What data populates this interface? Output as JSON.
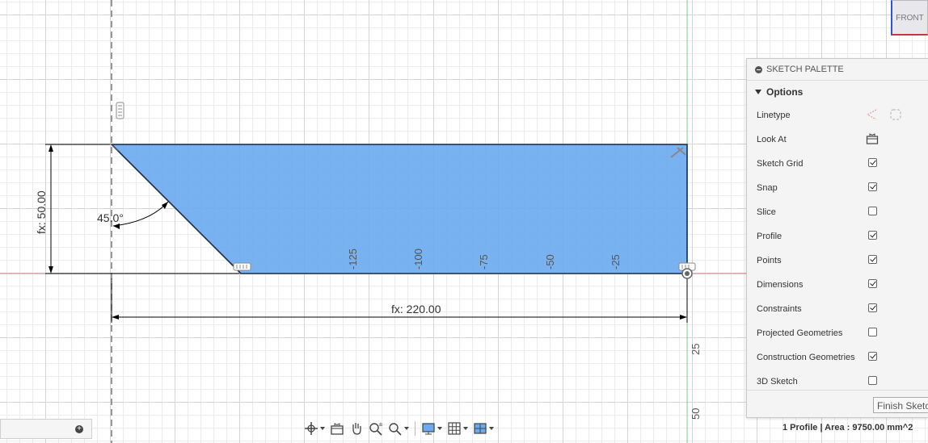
{
  "viewcube": {
    "label": "FRONT"
  },
  "sketch": {
    "dimension_vertical": "fx: 50.00",
    "dimension_horizontal": "fx: 220.00",
    "angle_label": "45.0°",
    "ruler_x_labels": [
      "-125",
      "-100",
      "-75",
      "-50",
      "-25"
    ],
    "ruler_y_labels": [
      "25",
      "50"
    ]
  },
  "palette": {
    "title": "SKETCH PALETTE",
    "section": "Options",
    "options": [
      {
        "label": "Linetype",
        "control": "linetype-icons"
      },
      {
        "label": "Look At",
        "control": "look-at-icon"
      },
      {
        "label": "Sketch Grid",
        "checked": true
      },
      {
        "label": "Snap",
        "checked": true
      },
      {
        "label": "Slice",
        "checked": false
      },
      {
        "label": "Profile",
        "checked": true
      },
      {
        "label": "Points",
        "checked": true
      },
      {
        "label": "Dimensions",
        "checked": true
      },
      {
        "label": "Constraints",
        "checked": true
      },
      {
        "label": "Projected Geometries",
        "checked": false
      },
      {
        "label": "Construction Geometries",
        "checked": true
      },
      {
        "label": "3D Sketch",
        "checked": false
      }
    ],
    "finish_button": "Finish Sketch"
  },
  "status": {
    "text": "1 Profile | Area : 9750.00 mm^2"
  },
  "colors": {
    "profile_fill": "#6aaaf0",
    "profile_stroke": "#1e2a44",
    "axis_red": "#e08080",
    "axis_green": "#7fcf7f"
  }
}
